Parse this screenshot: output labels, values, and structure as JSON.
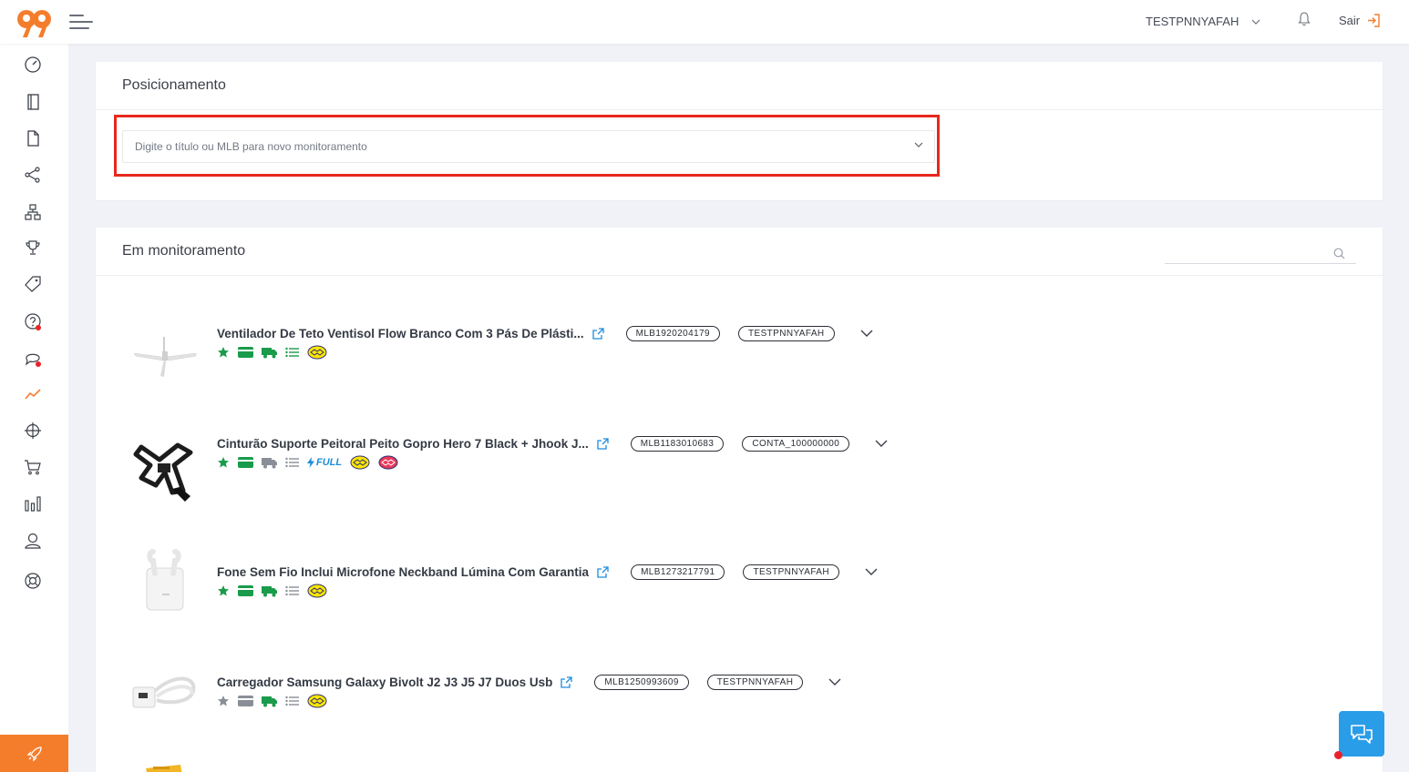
{
  "header": {
    "account_name": "TESTPNNYAFAH",
    "logout_label": "Sair"
  },
  "positioning": {
    "title": "Posicionamento",
    "select_placeholder": "Digite o título ou MLB para novo monitoramento"
  },
  "monitoring": {
    "title": "Em monitoramento",
    "search_value": "",
    "items": [
      {
        "title": "Ventilador De Teto Ventisol Flow Branco Com 3 Pás De Plásti...",
        "mlb": "MLB1920204179",
        "account": "TESTPNNYAFAH"
      },
      {
        "title": "Cinturão Suporte Peitoral Peito Gopro Hero 7 Black + Jhook J...",
        "mlb": "MLB1183010683",
        "account": "CONTA_100000000",
        "full_label": "FULL"
      },
      {
        "title": "Fone Sem Fio Inclui Microfone Neckband Lúmina Com Garantia",
        "mlb": "MLB1273217791",
        "account": "TESTPNNYAFAH"
      },
      {
        "title": "Carregador Samsung Galaxy Bivolt J2 J3 J5 J7 Duos Usb",
        "mlb": "MLB1250993609",
        "account": "TESTPNNYAFAH"
      }
    ]
  },
  "colors": {
    "brand_orange": "#f47d2c",
    "highlight_red": "#e8281c",
    "badge_green": "#1a9b4b",
    "badge_gray": "#8a8f97",
    "link_blue": "#1d8ddc",
    "chat_blue": "#2a9de8"
  },
  "icons": {
    "sidebar": [
      "dashboard-icon",
      "notebook-icon",
      "document-icon",
      "share-icon",
      "sitemap-icon",
      "trophy-icon",
      "tag-icon",
      "question-icon",
      "chat-bubble-icon",
      "trend-icon",
      "target-icon",
      "cart-icon",
      "bar-chart-icon",
      "user-icon",
      "lifebuoy-icon"
    ],
    "footer": "rocket-icon"
  }
}
